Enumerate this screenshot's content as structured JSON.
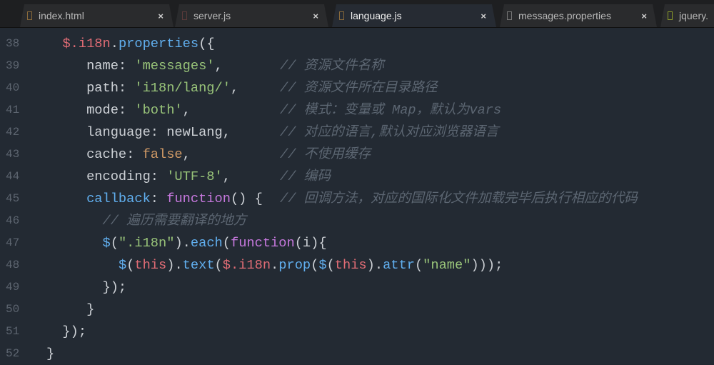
{
  "tabs": [
    {
      "label": "index.html",
      "icon_color": "#8a6a3a",
      "active": false
    },
    {
      "label": "server.js",
      "icon_color": "#5a3a3a",
      "active": false
    },
    {
      "label": "language.js",
      "icon_color": "#8a6a3a",
      "active": true
    },
    {
      "label": "messages.properties",
      "icon_color": "#777777",
      "active": false
    },
    {
      "label": "jquery.",
      "icon_color": "#8a9a2a",
      "active": false
    }
  ],
  "close_glyph": "×",
  "lines": [
    {
      "n": "38",
      "tokens": [
        [
          "plain",
          "  "
        ],
        [
          "dollar",
          "$.i18n"
        ],
        [
          "plain",
          "."
        ],
        [
          "fn",
          "properties"
        ],
        [
          "plain",
          "({"
        ]
      ]
    },
    {
      "n": "39",
      "tokens": [
        [
          "plain",
          "     name: "
        ],
        [
          "str",
          "'messages'"
        ],
        [
          "plain",
          ","
        ]
      ],
      "comment": "// 资源文件名称"
    },
    {
      "n": "40",
      "tokens": [
        [
          "plain",
          "     path: "
        ],
        [
          "str",
          "'i18n/lang/'"
        ],
        [
          "plain",
          ","
        ]
      ],
      "comment": "// 资源文件所在目录路径"
    },
    {
      "n": "41",
      "tokens": [
        [
          "plain",
          "     mode: "
        ],
        [
          "str",
          "'both'"
        ],
        [
          "plain",
          ","
        ]
      ],
      "comment": "// 模式：变量或 Map，默认为vars"
    },
    {
      "n": "42",
      "tokens": [
        [
          "plain",
          "     language: newLang,"
        ]
      ],
      "comment": "// 对应的语言,默认对应浏览器语言"
    },
    {
      "n": "43",
      "tokens": [
        [
          "plain",
          "     cache: "
        ],
        [
          "bool",
          "false"
        ],
        [
          "plain",
          ","
        ]
      ],
      "comment": "// 不使用缓存"
    },
    {
      "n": "44",
      "tokens": [
        [
          "plain",
          "     encoding: "
        ],
        [
          "str",
          "'UTF-8'"
        ],
        [
          "plain",
          ","
        ]
      ],
      "comment": "// 编码"
    },
    {
      "n": "45",
      "tokens": [
        [
          "plain",
          "     "
        ],
        [
          "prop",
          "callback"
        ],
        [
          "plain",
          ": "
        ],
        [
          "kw",
          "function"
        ],
        [
          "plain",
          "() {"
        ]
      ],
      "comment": "// 回调方法，对应的国际化文件加载完毕后执行相应的代码"
    },
    {
      "n": "46",
      "tokens": [
        [
          "plain",
          "       "
        ],
        [
          "cmt",
          "// 遍历需要翻译的地方"
        ]
      ]
    },
    {
      "n": "47",
      "tokens": [
        [
          "plain",
          "       "
        ],
        [
          "fn",
          "$"
        ],
        [
          "plain",
          "("
        ],
        [
          "str",
          "\".i18n\""
        ],
        [
          "plain",
          ")."
        ],
        [
          "fn",
          "each"
        ],
        [
          "plain",
          "("
        ],
        [
          "kw",
          "function"
        ],
        [
          "plain",
          "(i){"
        ]
      ]
    },
    {
      "n": "48",
      "tokens": [
        [
          "plain",
          "         "
        ],
        [
          "fn",
          "$"
        ],
        [
          "plain",
          "("
        ],
        [
          "this",
          "this"
        ],
        [
          "plain",
          ")."
        ],
        [
          "fn",
          "text"
        ],
        [
          "plain",
          "("
        ],
        [
          "dollar",
          "$.i18n"
        ],
        [
          "plain",
          "."
        ],
        [
          "fn",
          "prop"
        ],
        [
          "plain",
          "("
        ],
        [
          "fn",
          "$"
        ],
        [
          "plain",
          "("
        ],
        [
          "this",
          "this"
        ],
        [
          "plain",
          ")."
        ],
        [
          "fn",
          "attr"
        ],
        [
          "plain",
          "("
        ],
        [
          "str",
          "\"name\""
        ],
        [
          "plain",
          ")));"
        ]
      ]
    },
    {
      "n": "49",
      "tokens": [
        [
          "plain",
          "       });"
        ]
      ]
    },
    {
      "n": "50",
      "tokens": [
        [
          "plain",
          "     }"
        ]
      ]
    },
    {
      "n": "51",
      "tokens": [
        [
          "plain",
          "  });"
        ]
      ]
    },
    {
      "n": "52",
      "tokens": [
        [
          "plain",
          "}"
        ]
      ]
    }
  ]
}
